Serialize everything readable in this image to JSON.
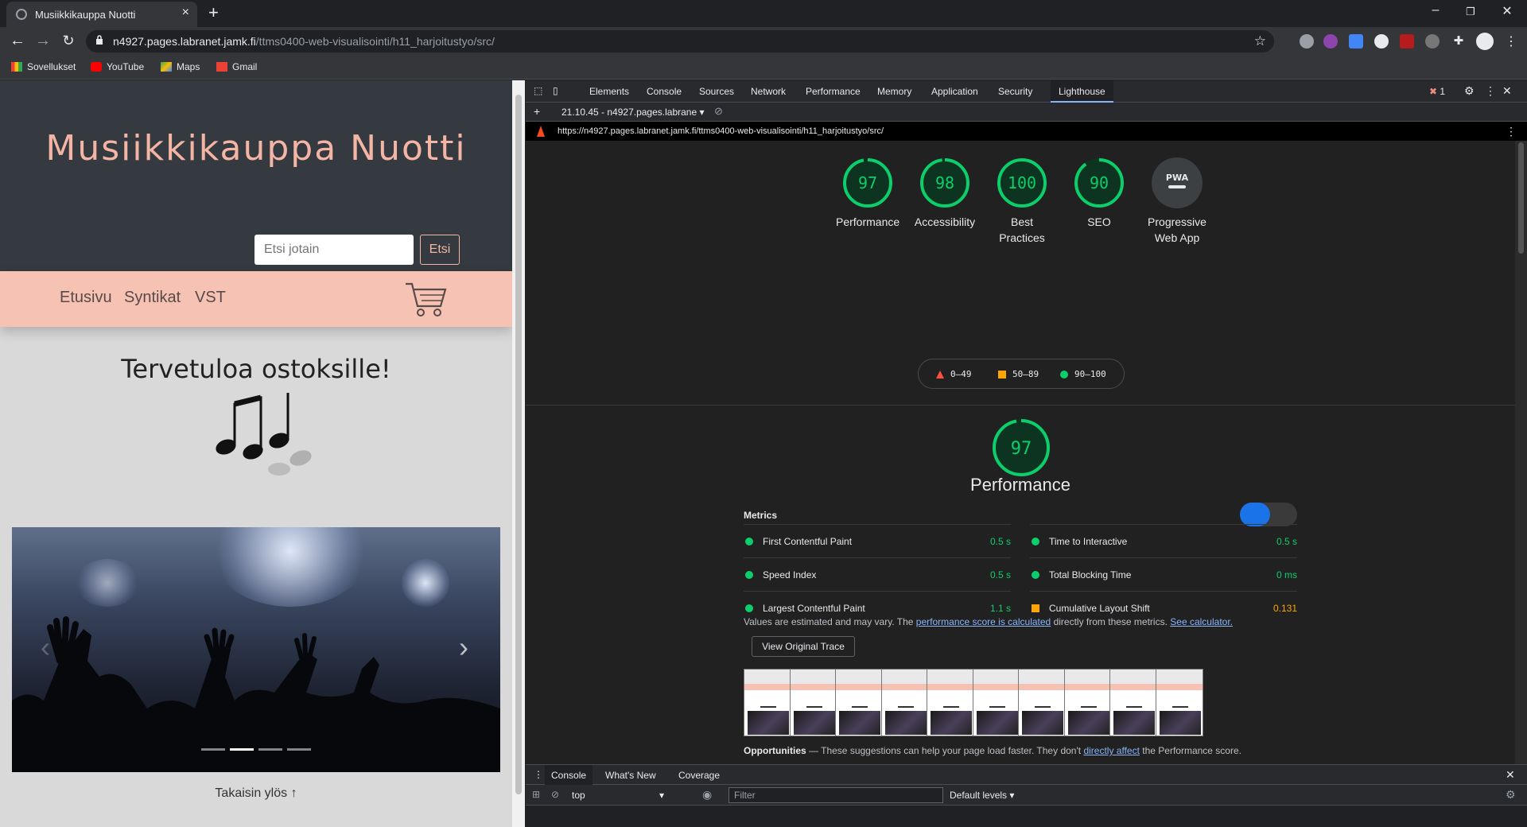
{
  "browser": {
    "tab_title": "Musiikkikauppa Nuotti",
    "url_host": "n4927.pages.labranet.jamk.fi",
    "url_path": "/ttms0400-web-visualisointi/h11_harjoitustyo/src/",
    "bookmarks": [
      "Sovellukset",
      "YouTube",
      "Maps",
      "Gmail"
    ]
  },
  "site": {
    "title": "Musiikkikauppa Nuotti",
    "search_placeholder": "Etsi jotain",
    "search_button": "Etsi",
    "nav": [
      "Etusivu",
      "Syntikat",
      "VST"
    ],
    "welcome": "Tervetuloa ostoksille!",
    "back_to_top": "Takaisin ylös ↑",
    "carousel_slides": 4,
    "carousel_active": 2
  },
  "devtools": {
    "tabs": [
      "Elements",
      "Console",
      "Sources",
      "Network",
      "Performance",
      "Memory",
      "Application",
      "Security",
      "Lighthouse"
    ],
    "active_tab": "Lighthouse",
    "error_count": "1",
    "report_selector": "21.10.45 - n4927.pages.labrane",
    "report_url": "https://n4927.pages.labranet.jamk.fi/ttms0400-web-visualisointi/h11_harjoitustyo/src/",
    "pwa_badge": "PWA",
    "scores": [
      {
        "label": "Performance",
        "value": 97
      },
      {
        "label": "Accessibility",
        "value": 98
      },
      {
        "label": "Best Practices",
        "value": 100
      },
      {
        "label": "SEO",
        "value": 90
      },
      {
        "label": "Progressive Web App",
        "value": null
      }
    ],
    "legend": [
      {
        "range": "0–49",
        "color": "#ff4e42"
      },
      {
        "range": "50–89",
        "color": "#ffa400"
      },
      {
        "range": "90–100",
        "color": "#0cce6b"
      }
    ],
    "perf_score": 97,
    "perf_title": "Performance",
    "metrics_heading": "Metrics",
    "metrics": [
      {
        "name": "First Contentful Paint",
        "value": "0.5 s",
        "status": "good"
      },
      {
        "name": "Time to Interactive",
        "value": "0.5 s",
        "status": "good"
      },
      {
        "name": "Speed Index",
        "value": "0.5 s",
        "status": "good"
      },
      {
        "name": "Total Blocking Time",
        "value": "0 ms",
        "status": "good"
      },
      {
        "name": "Largest Contentful Paint",
        "value": "1.1 s",
        "status": "good"
      },
      {
        "name": "Cumulative Layout Shift",
        "value": "0.131",
        "status": "average"
      }
    ],
    "estimated_text": "Values are estimated and may vary. The",
    "estimated_link": "performance score is calculated",
    "estimated_mid": "directly from these metrics.",
    "estimated_link2": "See calculator.",
    "trace_button": "View Original Trace",
    "opportunities_title": "Opportunities",
    "opportunities_text": "— These suggestions can help your page load faster. They don't",
    "opportunities_link": "directly affect",
    "opportunities_end": "the Performance score.",
    "drawer_tabs": [
      "Console",
      "What's New",
      "Coverage"
    ],
    "context": "top",
    "filter_placeholder": "Filter",
    "levels": "Default levels"
  },
  "colors": {
    "good": "#0cce6b",
    "average": "#ffa400",
    "poor": "#ff4e42",
    "accent": "#f4b5a4"
  }
}
